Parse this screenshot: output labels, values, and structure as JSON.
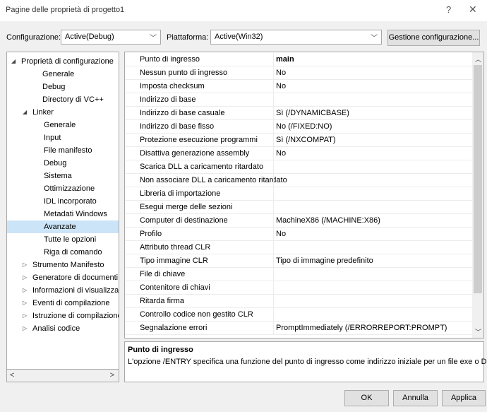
{
  "window": {
    "title": "Pagine delle proprietà di progetto1",
    "help_glyph": "?",
    "close_glyph": "✕"
  },
  "toolbar": {
    "config_label": "Configurazione:",
    "config_value": "Active(Debug)",
    "platform_label": "Piattaforma:",
    "platform_value": "Active(Win32)",
    "manage_button": "Gestione configurazione..."
  },
  "tree": [
    {
      "label": "Proprietà di configurazione",
      "arrow": "◢",
      "level": 0
    },
    {
      "label": "Generale",
      "arrow": "",
      "level": 1
    },
    {
      "label": "Debug",
      "arrow": "",
      "level": 1
    },
    {
      "label": "Directory di VC++",
      "arrow": "",
      "level": 1
    },
    {
      "label": "Linker",
      "arrow": "◢",
      "level": 1
    },
    {
      "label": "Generale",
      "arrow": "",
      "level": 2
    },
    {
      "label": "Input",
      "arrow": "",
      "level": 2
    },
    {
      "label": "File manifesto",
      "arrow": "",
      "level": 2
    },
    {
      "label": "Debug",
      "arrow": "",
      "level": 2
    },
    {
      "label": "Sistema",
      "arrow": "",
      "level": 2
    },
    {
      "label": "Ottimizzazione",
      "arrow": "",
      "level": 2
    },
    {
      "label": "IDL incorporato",
      "arrow": "",
      "level": 2
    },
    {
      "label": "Metadati Windows",
      "arrow": "",
      "level": 2
    },
    {
      "label": "Avanzate",
      "arrow": "",
      "level": 2,
      "selected": true
    },
    {
      "label": "Tutte le opzioni",
      "arrow": "",
      "level": 2
    },
    {
      "label": "Riga di comando",
      "arrow": "",
      "level": 2
    },
    {
      "label": "Strumento Manifesto",
      "arrow": "▷",
      "level": 1
    },
    {
      "label": "Generatore di documenti X",
      "arrow": "▷",
      "level": 1
    },
    {
      "label": "Informazioni di visualizzazi",
      "arrow": "▷",
      "level": 1
    },
    {
      "label": "Eventi di compilazione",
      "arrow": "▷",
      "level": 1
    },
    {
      "label": "Istruzione di compilazione",
      "arrow": "▷",
      "level": 1
    },
    {
      "label": "Analisi codice",
      "arrow": "▷",
      "level": 1
    }
  ],
  "tree_scroll": {
    "left": "<",
    "right": ">"
  },
  "properties": [
    {
      "name": "Punto di ingresso",
      "value": "main",
      "bold": true
    },
    {
      "name": "Nessun punto di ingresso",
      "value": "No"
    },
    {
      "name": "Imposta checksum",
      "value": "No"
    },
    {
      "name": "Indirizzo di base",
      "value": ""
    },
    {
      "name": "Indirizzo di base casuale",
      "value": "Sì (/DYNAMICBASE)"
    },
    {
      "name": "Indirizzo di base fisso",
      "value": "No (/FIXED:NO)"
    },
    {
      "name": "Protezione esecuzione programmi",
      "value": "Sì (/NXCOMPAT)"
    },
    {
      "name": "Disattiva generazione assembly",
      "value": "No"
    },
    {
      "name": "Scarica DLL a caricamento ritardato",
      "value": ""
    },
    {
      "name": "Non associare DLL a caricamento ritardato",
      "value": ""
    },
    {
      "name": "Libreria di importazione",
      "value": ""
    },
    {
      "name": "Esegui merge delle sezioni",
      "value": ""
    },
    {
      "name": "Computer di destinazione",
      "value": "MachineX86 (/MACHINE:X86)"
    },
    {
      "name": "Profilo",
      "value": "No"
    },
    {
      "name": "Attributo thread CLR",
      "value": ""
    },
    {
      "name": "Tipo immagine CLR",
      "value": "Tipo di immagine predefinito"
    },
    {
      "name": "File di chiave",
      "value": ""
    },
    {
      "name": "Contenitore di chiavi",
      "value": ""
    },
    {
      "name": "Ritarda firma",
      "value": ""
    },
    {
      "name": "Controllo codice non gestito CLR",
      "value": ""
    },
    {
      "name": "Segnalazione errori",
      "value": "PromptImmediately (/ERRORREPORT:PROMPT)"
    }
  ],
  "description": {
    "title": "Punto di ingresso",
    "text": "L'opzione /ENTRY specifica una funzione del punto di ingresso come indirizzo iniziale per un file exe o DLL."
  },
  "buttons": {
    "ok": "OK",
    "cancel": "Annulla",
    "apply": "Applica"
  }
}
